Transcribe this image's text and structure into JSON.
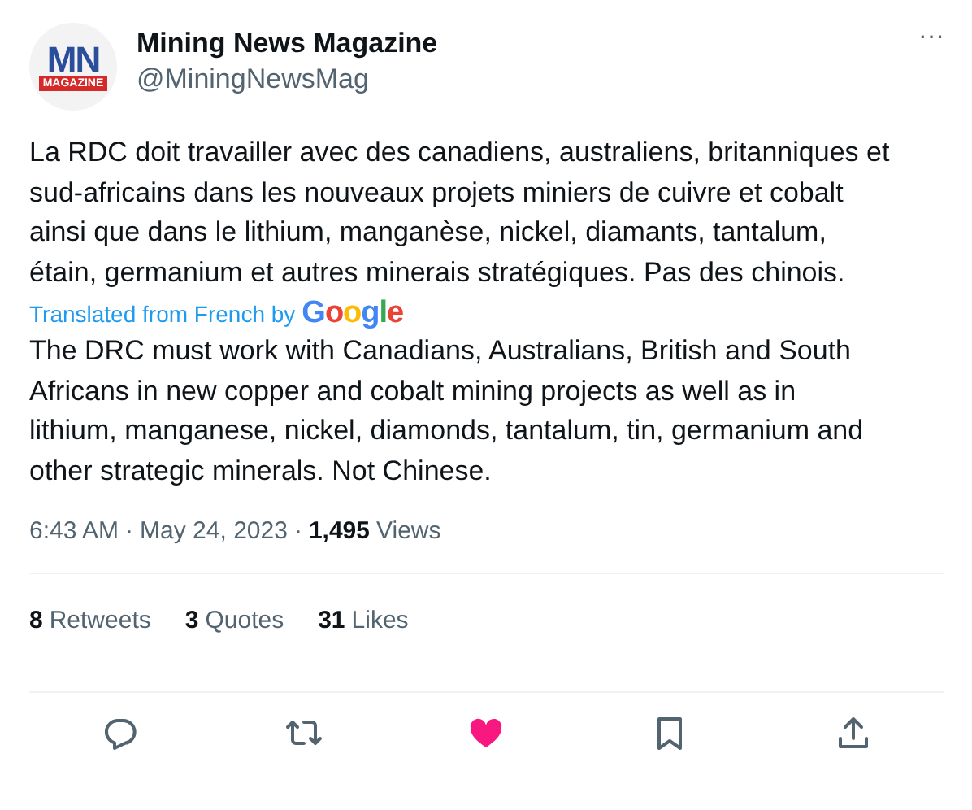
{
  "author": {
    "name": "Mining News Magazine",
    "handle": "@MiningNewsMag",
    "logo_letters": "MN",
    "logo_banner": "MAGAZINE"
  },
  "more_button": "···",
  "text": "La RDC doit travailler avec des canadiens, australiens, britanniques et sud-africains dans les nouveaux projets miniers de cuivre et cobalt ainsi que dans le lithium, manganèse, nickel, diamants, tantalum, étain, germanium et autres minerais stratégiques. Pas des chinois.",
  "translation": {
    "label": "Translated from French by",
    "provider": "Google",
    "text": "The DRC must work with Canadians, Australians, British and South Africans in new copper and cobalt mining projects as well as in lithium, manganese, nickel, diamonds, tantalum, tin, germanium and other strategic minerals. Not Chinese."
  },
  "meta": {
    "time": "6:43 AM",
    "separator_1": "·",
    "date": "May 24, 2023",
    "separator_2": "·",
    "views_count": "1,495",
    "views_label": "Views"
  },
  "stats": [
    {
      "count": "8",
      "label": "Retweets"
    },
    {
      "count": "3",
      "label": "Quotes"
    },
    {
      "count": "31",
      "label": "Likes"
    }
  ],
  "actions": [
    {
      "kind": "reply",
      "on": false
    },
    {
      "kind": "retweet",
      "on": false
    },
    {
      "kind": "like",
      "on": true
    },
    {
      "kind": "bookmark",
      "on": false
    },
    {
      "kind": "share",
      "on": false
    }
  ]
}
